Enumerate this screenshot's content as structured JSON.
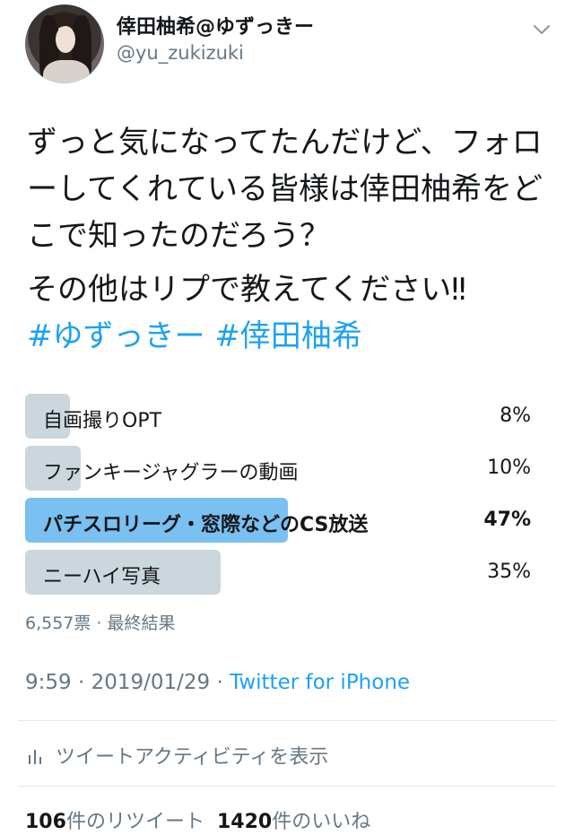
{
  "user": {
    "display_name": "倖田柚希@ゆずっきー",
    "handle": "@yu_zukizuki"
  },
  "tweet": {
    "text_line1": "ずっと気になってたんだけど、フォローしてくれている皆様は倖田柚希をどこで知ったのだろう？",
    "text_line2": "その他はリプで教えてください‼︎",
    "hashtags": "#ゆずっきー #倖田柚希"
  },
  "poll": {
    "options": [
      {
        "label": "自画撮りOPT",
        "percent_text": "8%",
        "percent": 8
      },
      {
        "label": "ファンキージャグラーの動画",
        "percent_text": "10%",
        "percent": 10
      },
      {
        "label": "パチスロリーグ・窓際などのCS放送",
        "percent_text": "47%",
        "percent": 47,
        "winner": true
      },
      {
        "label": "ニーハイ写真",
        "percent_text": "35%",
        "percent": 35
      }
    ],
    "meta": "6,557票 · 最終結果"
  },
  "meta": {
    "time_date": "9:59 · 2019/01/29 · ",
    "via": "Twitter for iPhone"
  },
  "activity": {
    "label": "ツイートアクティビティを表示",
    "icon": "bar-chart-icon"
  },
  "stats": {
    "retweets_count": "106",
    "retweets_label": "件のリツイート",
    "likes_count": "1420",
    "likes_label": "件のいいね"
  },
  "colors": {
    "link": "#1da1f2",
    "poll_winner": "#7ac0f0",
    "poll_other": "#ccd6dd",
    "secondary_text": "#657786"
  }
}
